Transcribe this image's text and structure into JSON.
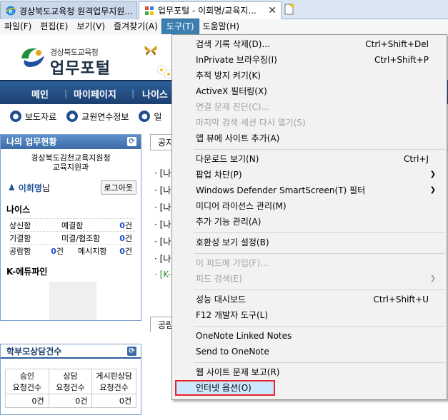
{
  "tabs": [
    {
      "label": "경상북도교육청 원격업무지원...",
      "active": false
    },
    {
      "label": "업무포털 - 이회명/교육지...",
      "active": true
    }
  ],
  "menubar": [
    {
      "label": "파일(F)"
    },
    {
      "label": "편집(E)"
    },
    {
      "label": "보기(V)"
    },
    {
      "label": "즐겨찾기(A)"
    },
    {
      "label": "도구(T)",
      "open": true
    },
    {
      "label": "도움말(H)"
    }
  ],
  "site": {
    "logo_sub": "경상북도교육청",
    "logo_main": "업무포털",
    "nav": [
      "메인",
      "마이페이지",
      "나이스"
    ],
    "quicklinks": [
      "보도자료",
      "교원연수정보",
      "일"
    ]
  },
  "left_panel": {
    "title": "나의 업무현황",
    "org_line1": "경상북도김천교육지원청",
    "org_line2": "교육지원과",
    "user_name": "이회명",
    "user_suffix": "님",
    "logout": "로그아웃",
    "neis_title": "나이스",
    "stats": [
      {
        "k1": "상신함",
        "v1": "",
        "k2": "예결함",
        "v2": "0",
        "v2u": "건"
      },
      {
        "k1": "기결함",
        "v1": "",
        "k2": "미결/협조함",
        "v2": "0",
        "v2u": "건"
      },
      {
        "k1": "공람함",
        "v1": "0",
        "v1u": "건",
        "k2": "메시지함",
        "v2": "0",
        "v2u": "건"
      }
    ],
    "edufine_title": "K-에듀파인"
  },
  "parent_panel": {
    "title": "학부모상담건수",
    "headers": [
      [
        "승인",
        "요청건수"
      ],
      [
        "상담",
        "요청건수"
      ],
      [
        "게시판상담",
        "요청건수"
      ]
    ],
    "values": [
      "0건",
      "0건",
      "0건"
    ]
  },
  "main": {
    "tab1": "공지",
    "tab2": "공람",
    "items": [
      "· [나",
      "· [나",
      "· [나",
      "· [나",
      "· [나",
      "· [나",
      "· [K-"
    ]
  },
  "tools_menu": {
    "groups": [
      [
        {
          "label": "검색 기록 삭제(D)...",
          "shortcut": "Ctrl+Shift+Del"
        },
        {
          "label": "InPrivate 브라우징(I)",
          "shortcut": "Ctrl+Shift+P"
        },
        {
          "label": "추적 방지 켜기(K)"
        },
        {
          "label": "ActiveX 필터링(X)"
        },
        {
          "label": "연결 문제 진단(C)...",
          "disabled": true
        },
        {
          "label": "마지막 검색 세션 다시 열기(S)",
          "disabled": true
        },
        {
          "label": "앱 뷰에 사이트 추가(A)"
        }
      ],
      [
        {
          "label": "다운로드 보기(N)",
          "shortcut": "Ctrl+J"
        },
        {
          "label": "팝업 차단(P)",
          "submenu": true
        },
        {
          "label": "Windows Defender SmartScreen(T) 필터",
          "submenu": true
        },
        {
          "label": "미디어 라이선스 관리(M)"
        },
        {
          "label": "추가 기능 관리(A)"
        }
      ],
      [
        {
          "label": "호환성 보기 설정(B)"
        }
      ],
      [
        {
          "label": "이 피드에 가입(F)...",
          "disabled": true
        },
        {
          "label": "피드 검색(E)",
          "disabled": true,
          "submenu": true
        }
      ],
      [
        {
          "label": "성능 대시보드",
          "shortcut": "Ctrl+Shift+U"
        },
        {
          "label": "F12 개발자 도구(L)"
        }
      ],
      [
        {
          "label": "OneNote Linked Notes"
        },
        {
          "label": "Send to OneNote"
        }
      ],
      [
        {
          "label": "웹 사이트 문제 보고(R)"
        },
        {
          "label": "인터넷 옵션(O)",
          "selected": true
        }
      ]
    ]
  },
  "colors": {
    "menu_open": "#3c7fb1",
    "nav_bg": "#2d5f98",
    "highlight_box": "#e8232a",
    "selected_item_bg": "#cce8ff"
  }
}
